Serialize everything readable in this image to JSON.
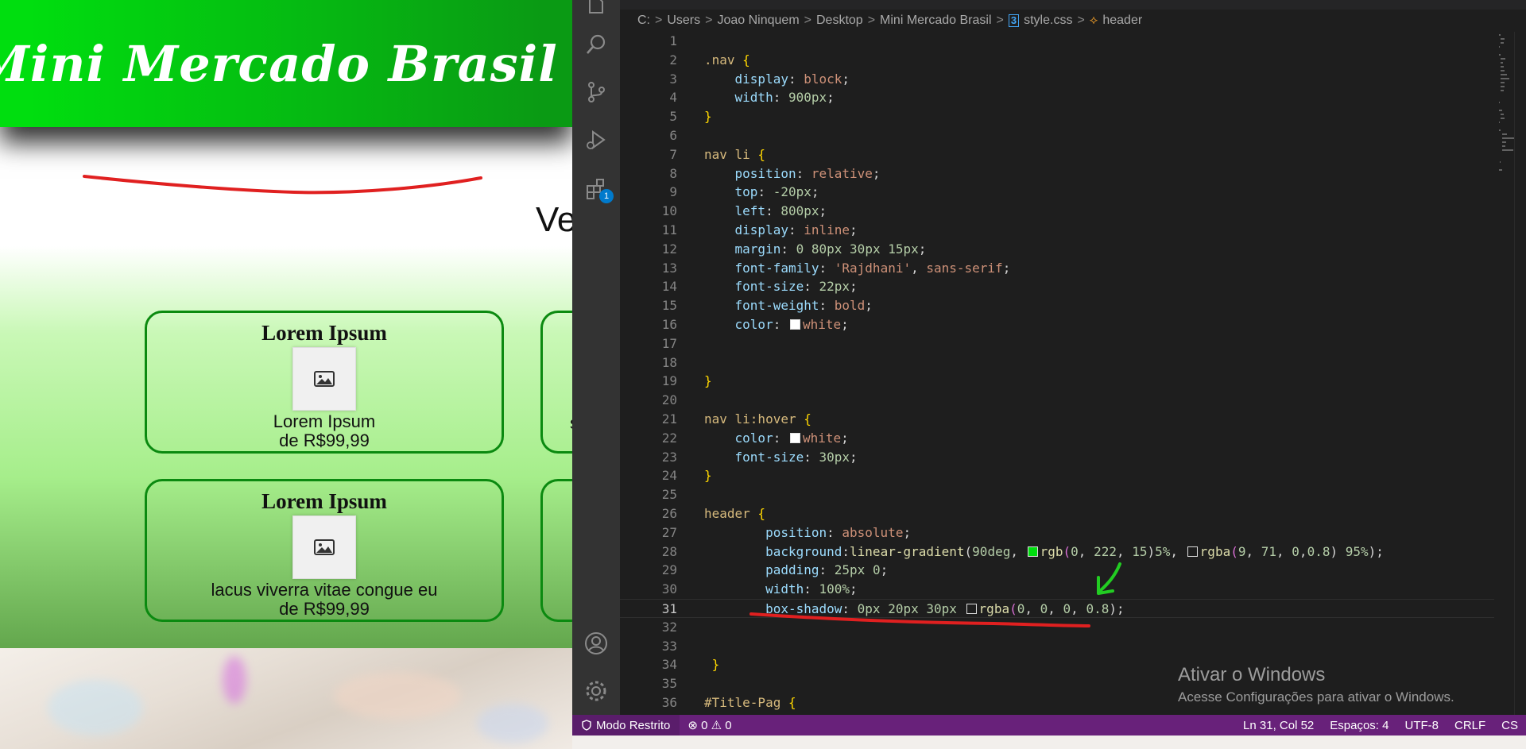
{
  "site": {
    "title": "Mini Mercado Brasil",
    "page_title_fragment": "Ve",
    "cards": [
      {
        "title": "Lorem Ipsum",
        "desc_line1": "Lorem Ipsum",
        "desc_line2": "de R$99,99"
      },
      {
        "title": "Lorem Ipsum",
        "desc_line1": "lacus viverra vitae congue eu",
        "desc_line2": "de R$99,99"
      }
    ],
    "partial_card_text": "s"
  },
  "editor": {
    "breadcrumb": [
      "C:",
      "Users",
      "Joao Ninquem",
      "Desktop",
      "Mini Mercado Brasil",
      "style.css",
      "header"
    ],
    "breadcrumb_file_icon": "css-file-icon",
    "breadcrumb_symbol_icon": "symbol-class-icon",
    "active_line": 31,
    "lines": [
      "",
      ".nav {",
      "    display: block;",
      "    width: 900px;",
      "}",
      "",
      "nav li {",
      "    position: relative;",
      "    top: -20px;",
      "    left: 800px;",
      "    display: inline;",
      "    margin: 0 80px 30px 15px;",
      "    font-family: 'Rajdhani', sans-serif;",
      "    font-size: 22px;",
      "    font-weight: bold;",
      "    color: white;",
      "",
      "",
      "}",
      "",
      "nav li:hover {",
      "    color: white;",
      "    font-size: 30px;",
      "}",
      "",
      "header {",
      "        position: absolute;",
      "        background:linear-gradient(90deg, rgb(0, 222, 15)5%, rgba(9, 71, 0,0.8) 95%);",
      "        padding: 25px 0;",
      "        width: 100%;",
      "        box-shadow: 0px 20px 30px rgba(0, 0, 0, 0.8);",
      "",
      "",
      " }",
      "",
      "#Title-Pag {"
    ]
  },
  "activity_bar": {
    "icons": [
      "explorer-icon",
      "search-icon",
      "source-control-icon",
      "run-debug-icon",
      "extensions-icon",
      "account-icon",
      "settings-gear-icon"
    ],
    "extensions_badge": "1"
  },
  "watermark": {
    "line1": "Ativar o Windows",
    "line2": "Acesse Configurações para ativar o Windows."
  },
  "status_bar": {
    "restricted_mode": "Modo Restrito",
    "errors": "0",
    "warnings": "0",
    "cursor": "Ln 31, Col 52",
    "spaces": "Espaços: 4",
    "encoding": "UTF-8",
    "eol": "CRLF",
    "language": "CS"
  },
  "colors": {
    "header_gradient_start": "#00de0f",
    "header_gradient_end": "#0a9a14",
    "status_bar": "#68217a",
    "annotation_red": "#e02020",
    "annotation_green": "#22cc22"
  }
}
